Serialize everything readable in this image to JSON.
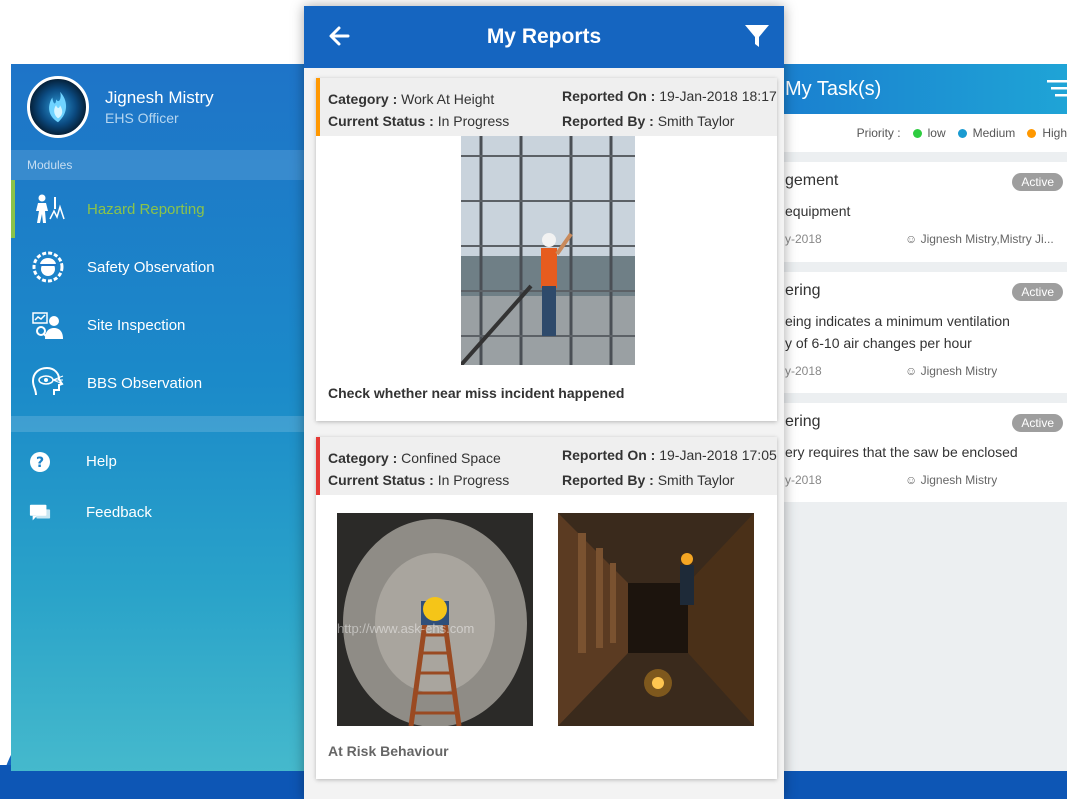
{
  "side_menu": {
    "user_name": "Jignesh Mistry",
    "user_role": "EHS Officer",
    "section_label": "Modules",
    "items": [
      {
        "label": "Hazard Reporting",
        "icon": "hazard-worker-icon",
        "active": true
      },
      {
        "label": "Safety Observation",
        "icon": "safety-helmet-gear-icon",
        "active": false
      },
      {
        "label": "Site Inspection",
        "icon": "site-inspector-icon",
        "active": false
      },
      {
        "label": "BBS Observation",
        "icon": "head-eye-icon",
        "active": false
      }
    ],
    "help_label": "Help",
    "feedback_label": "Feedback",
    "active_color": "#8bc34a"
  },
  "reports": {
    "title": "My Reports",
    "cards": [
      {
        "category_label": "Category :",
        "category_value": "Work At Height",
        "status_label": "Current Status :",
        "status_value": "In Progress",
        "reported_on_label": "Reported On :",
        "reported_on_value": "19-Jan-2018 18:17",
        "reported_by_label": "Reported By :",
        "reported_by_value": "Smith Taylor",
        "caption": "Check whether near miss incident happened",
        "accent": "#ff9800"
      },
      {
        "category_label": "Category :",
        "category_value": "Confined Space",
        "status_label": "Current Status :",
        "status_value": "In Progress",
        "reported_on_label": "Reported On :",
        "reported_on_value": "19-Jan-2018 17:05",
        "reported_by_label": "Reported By :",
        "reported_by_value": "Smith Taylor",
        "caption": "At Risk Behaviour",
        "accent": "#e53935",
        "watermark": "http://www.ask-ehs.com"
      }
    ]
  },
  "tasks": {
    "title": "My Task(s)",
    "priority_label": "Priority :",
    "priorities": [
      {
        "label": "low",
        "color": "#2ecc40"
      },
      {
        "label": "Medium",
        "color": "#1a9bd1"
      },
      {
        "label": "High",
        "color": "#ff9800"
      }
    ],
    "items": [
      {
        "title": "gement",
        "badge": "Active",
        "desc_1": "equipment",
        "desc_2": "",
        "date": "y-2018",
        "user": "Jignesh Mistry,Mistry Ji..."
      },
      {
        "title": "ering",
        "badge": "Active",
        "desc_1": "eing indicates a minimum ventilation",
        "desc_2": "y of 6-10 air changes per hour",
        "date": "y-2018",
        "user": "Jignesh Mistry"
      },
      {
        "title": "ering",
        "badge": "Active",
        "desc_1": "ery requires that the saw be enclosed",
        "desc_2": "",
        "date": "y-2018",
        "user": "Jignesh Mistry"
      }
    ]
  }
}
